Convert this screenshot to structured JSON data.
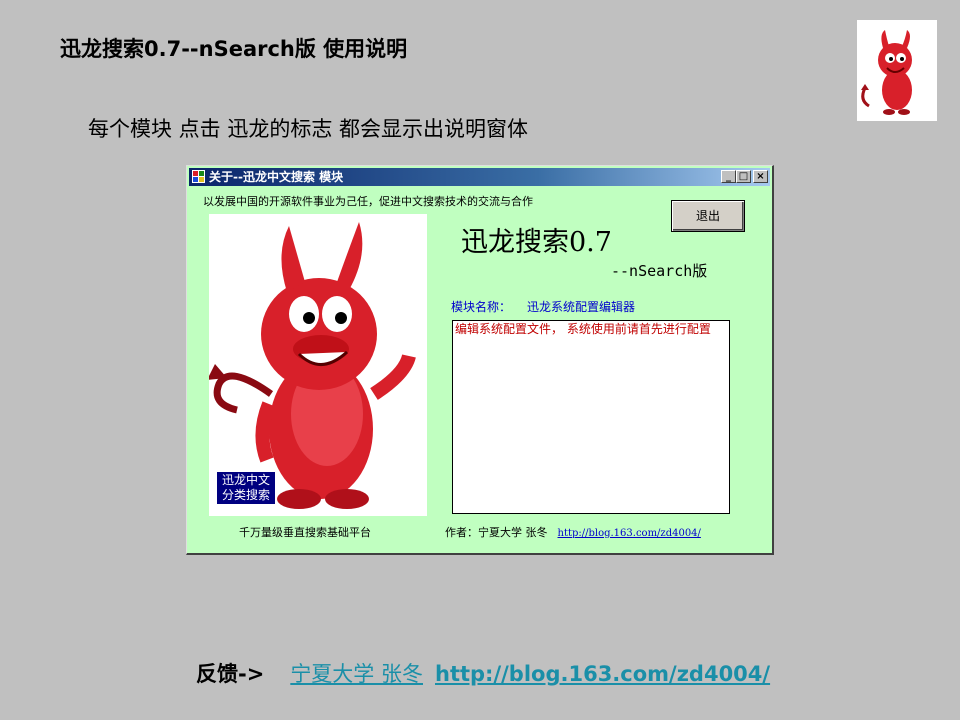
{
  "slide": {
    "title": "迅龙搜索0.7--nSearch版  使用说明",
    "subtitle": "每个模块 点击 迅龙的标志 都会显示出说明窗体"
  },
  "window": {
    "title": "关于--迅龙中文搜索 模块",
    "min_btn": "_",
    "max_btn": "□",
    "close_btn": "×",
    "mission": "以发展中国的开源软件事业为己任，促进中文搜索技术的交流与合作",
    "exit_label": "退出",
    "app_title": "迅龙搜索0.7",
    "app_sub": "--nSearch版",
    "module_label": "模块名称：",
    "module_value": "迅龙系统配置编辑器",
    "description": "编辑系统配置文件，  系统使用前请首先进行配置",
    "mascot_caption_1": "迅龙中文",
    "mascot_caption_2": "分类搜索",
    "platform": "千万量级垂直搜索基础平台",
    "author": "作者：宁夏大学 张冬",
    "author_url": "http://blog.163.com/zd4004/"
  },
  "footer": {
    "label": "反馈->",
    "name": "宁夏大学 张冬",
    "url": "http://blog.163.com/zd4004/"
  },
  "colors": {
    "slide_bg": "#c0c0c0",
    "window_bg": "#c0ffc0",
    "title_bar": "#0a246a",
    "link": "#1a8fa8",
    "mascot_red": "#d8202a"
  },
  "icons": {
    "logo": "devil-mascot-icon",
    "app": "app-icon"
  }
}
